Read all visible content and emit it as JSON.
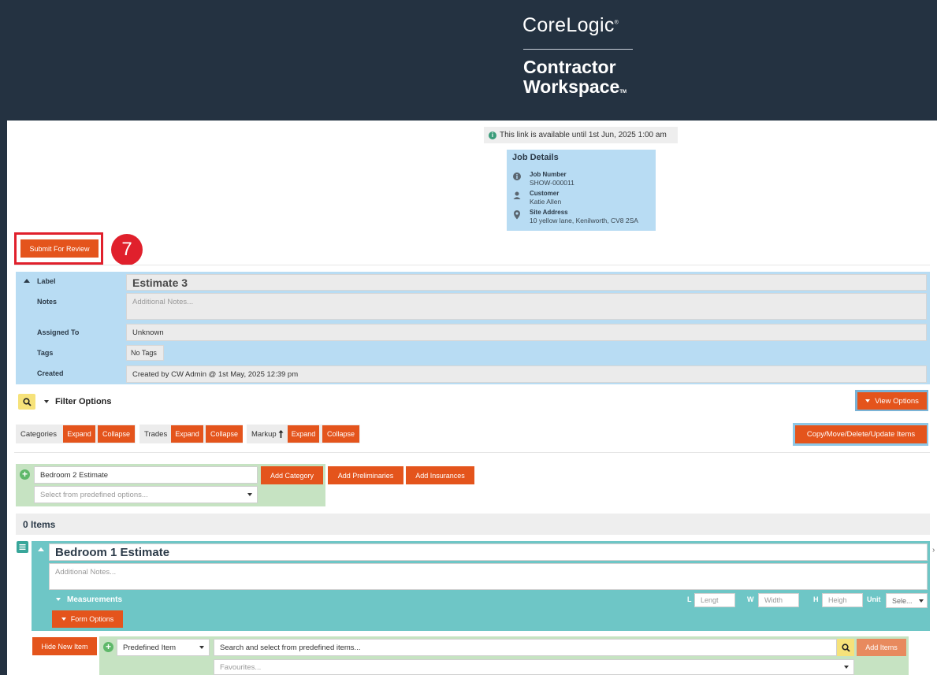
{
  "header": {
    "logo_primary": "CoreLogic",
    "logo_registered": "®",
    "logo_secondary_line1": "Contractor",
    "logo_secondary_line2": "Workspace",
    "logo_tm": "TM"
  },
  "banner": {
    "icon": "info-icon",
    "text": "This link is available until 1st Jun, 2025 1:00 am"
  },
  "job_details": {
    "title": "Job Details",
    "rows": [
      {
        "icon": "info-icon",
        "label": "Job Number",
        "value": "SHOW-000011"
      },
      {
        "icon": "person-icon",
        "label": "Customer",
        "value": "Katie Allen"
      },
      {
        "icon": "location-pin-icon",
        "label": "Site Address",
        "value": "10 yellow lane, Kenilworth, CV8 2SA"
      }
    ]
  },
  "submit_label": "Submit For Review",
  "step_number": "7",
  "estimate": {
    "label_label": "Label",
    "label_value": "Estimate 3",
    "notes_label": "Notes",
    "notes_placeholder": "Additional Notes...",
    "assigned_label": "Assigned To",
    "assigned_value": "Unknown",
    "tags_label": "Tags",
    "tags_value": "No Tags",
    "created_label": "Created",
    "created_value": "Created by CW Admin @ 1st May, 2025 12:39 pm"
  },
  "filter": {
    "label": "Filter Options",
    "view_options": "View Options"
  },
  "groups": {
    "categories": "Categories",
    "trades": "Trades",
    "markup": "Markup",
    "markup_icon": "sort-arrow-icon",
    "expand": "Expand",
    "collapse": "Collapse",
    "copy_move": "Copy/Move/Delete/Update Items"
  },
  "add_category": {
    "input_value": "Bedroom 2 Estimate",
    "select_placeholder": "Select from predefined options...",
    "add_category": "Add Category",
    "add_preliminaries": "Add Preliminaries",
    "add_insurances": "Add Insurances"
  },
  "items_count": "0 Items",
  "category": {
    "title": "Bedroom 1 Estimate",
    "notes_placeholder": "Additional Notes...",
    "measurements": "Measurements",
    "l_label": "L",
    "l_placeholder": "Lengt",
    "w_label": "W",
    "w_placeholder": "Width",
    "h_label": "H",
    "h_placeholder": "Heigh",
    "unit_label": "Unit",
    "unit_value": "Sele...",
    "form_options": "Form Options"
  },
  "new_item": {
    "hide_new_item": "Hide New Item",
    "type_value": "Predefined Item",
    "search_placeholder": "Search and select from predefined items...",
    "add_items": "Add Items",
    "favourites_placeholder": "Favourites..."
  },
  "colors": {
    "header_bg": "#243241",
    "accent_orange": "#e4541c",
    "light_blue": "#b8dcf3",
    "teal": "#6ec6c6",
    "green_panel": "#c6e3c2",
    "highlight_red": "#e0202c"
  }
}
